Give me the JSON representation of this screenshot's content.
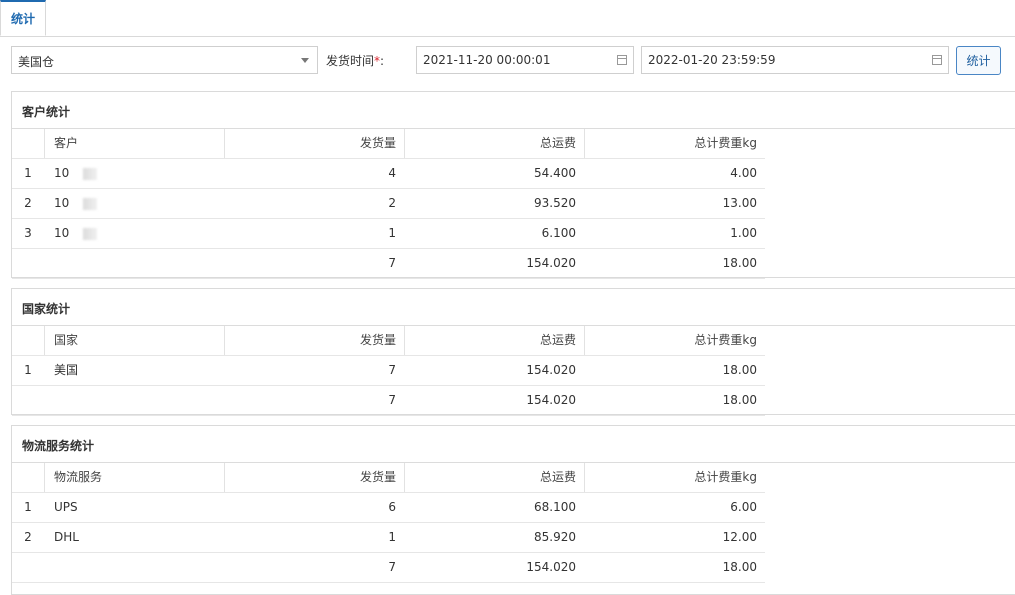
{
  "tabs": [
    {
      "label": "统计"
    }
  ],
  "filters": {
    "warehouse": "美国仓",
    "ship_time_label": "发货时间",
    "required_mark": "*",
    "colon": ":",
    "start_time": "2021-11-20 00:00:01",
    "end_time": "2022-01-20 23:59:59",
    "submit_label": "统计"
  },
  "customer_stats": {
    "title": "客户统计",
    "headers": [
      "客户",
      "发货量",
      "总运费",
      "总计费重kg"
    ],
    "rows": [
      {
        "idx": "1",
        "name": "10",
        "qty": "4",
        "fee": "54.400",
        "weight": "4.00"
      },
      {
        "idx": "2",
        "name": "10",
        "qty": "2",
        "fee": "93.520",
        "weight": "13.00"
      },
      {
        "idx": "3",
        "name": "10",
        "qty": "1",
        "fee": "6.100",
        "weight": "1.00"
      }
    ],
    "total": {
      "qty": "7",
      "fee": "154.020",
      "weight": "18.00"
    }
  },
  "country_stats": {
    "title": "国家统计",
    "headers": [
      "国家",
      "发货量",
      "总运费",
      "总计费重kg"
    ],
    "rows": [
      {
        "idx": "1",
        "name": "美国",
        "qty": "7",
        "fee": "154.020",
        "weight": "18.00"
      }
    ],
    "total": {
      "qty": "7",
      "fee": "154.020",
      "weight": "18.00"
    }
  },
  "logistics_stats": {
    "title": "物流服务统计",
    "headers": [
      "物流服务",
      "发货量",
      "总运费",
      "总计费重kg"
    ],
    "rows": [
      {
        "idx": "1",
        "name": "UPS",
        "qty": "6",
        "fee": "68.100",
        "weight": "6.00"
      },
      {
        "idx": "2",
        "name": "DHL",
        "qty": "1",
        "fee": "85.920",
        "weight": "12.00"
      }
    ],
    "total": {
      "qty": "7",
      "fee": "154.020",
      "weight": "18.00"
    }
  }
}
